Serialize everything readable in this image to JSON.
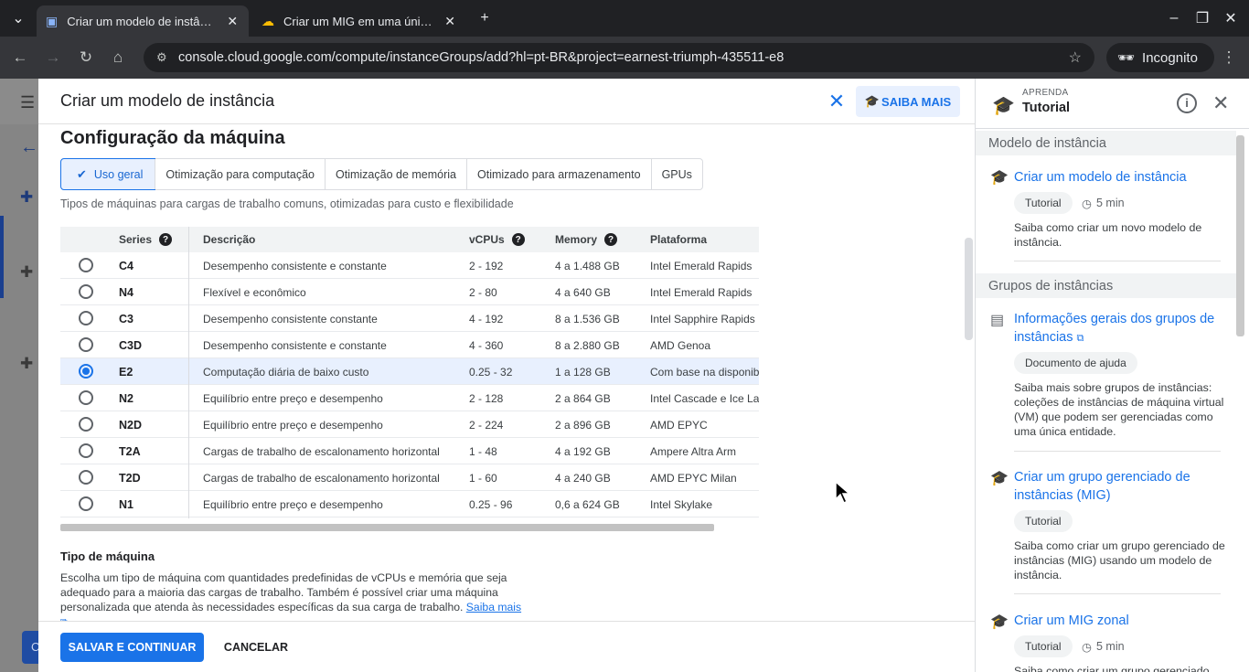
{
  "browser": {
    "tabs": [
      {
        "title": "Criar um modelo de instância",
        "active": true
      },
      {
        "title": "Criar um MIG em uma única zona",
        "active": false
      }
    ],
    "url": "console.cloud.google.com/compute/instanceGroups/add?hl=pt-BR&project=earnest-triumph-435511-e8",
    "incognito_label": "Incognito"
  },
  "dialog": {
    "title": "Criar um modelo de instância",
    "learn_more": "SAIBA MAIS",
    "section_title": "Configuração da máquina",
    "family_tabs": [
      {
        "label": "Uso geral",
        "selected": true
      },
      {
        "label": "Otimização para computação",
        "selected": false
      },
      {
        "label": "Otimização de memória",
        "selected": false
      },
      {
        "label": "Otimizado para armazenamento",
        "selected": false
      },
      {
        "label": "GPUs",
        "selected": false
      }
    ],
    "family_description": "Tipos de máquinas para cargas de trabalho comuns, otimizadas para custo e flexibilidade",
    "table": {
      "headers": {
        "series": "Series",
        "description": "Descrição",
        "vcpus": "vCPUs",
        "memory": "Memory",
        "platform": "Plataforma"
      },
      "rows": [
        {
          "series": "C4",
          "description": "Desempenho consistente e constante",
          "vcpus": "2 - 192",
          "memory": "4 a 1.488 GB",
          "platform": "Intel Emerald Rapids",
          "selected": false
        },
        {
          "series": "N4",
          "description": "Flexível e econômico",
          "vcpus": "2 - 80",
          "memory": "4 a 640 GB",
          "platform": "Intel Emerald Rapids",
          "selected": false
        },
        {
          "series": "C3",
          "description": "Desempenho consistente constante",
          "vcpus": "4 - 192",
          "memory": "8 a 1.536 GB",
          "platform": "Intel Sapphire Rapids",
          "selected": false
        },
        {
          "series": "C3D",
          "description": "Desempenho consistente e constante",
          "vcpus": "4 - 360",
          "memory": "8 a 2.880 GB",
          "platform": "AMD Genoa",
          "selected": false
        },
        {
          "series": "E2",
          "description": "Computação diária de baixo custo",
          "vcpus": "0.25 - 32",
          "memory": "1 a 128 GB",
          "platform": "Com base na disponibilidade",
          "selected": true
        },
        {
          "series": "N2",
          "description": "Equilíbrio entre preço e desempenho",
          "vcpus": "2 - 128",
          "memory": "2 a 864 GB",
          "platform": "Intel Cascade e Ice Lake",
          "selected": false
        },
        {
          "series": "N2D",
          "description": "Equilíbrio entre preço e desempenho",
          "vcpus": "2 - 224",
          "memory": "2 a 896 GB",
          "platform": "AMD EPYC",
          "selected": false
        },
        {
          "series": "T2A",
          "description": "Cargas de trabalho de escalonamento horizontal",
          "vcpus": "1 - 48",
          "memory": "4 a 192 GB",
          "platform": "Ampere Altra Arm",
          "selected": false
        },
        {
          "series": "T2D",
          "description": "Cargas de trabalho de escalonamento horizontal",
          "vcpus": "1 - 60",
          "memory": "4 a 240 GB",
          "platform": "AMD EPYC Milan",
          "selected": false
        },
        {
          "series": "N1",
          "description": "Equilíbrio entre preço e desempenho",
          "vcpus": "0.25 - 96",
          "memory": "0,6 a 624 GB",
          "platform": "Intel Skylake",
          "selected": false
        }
      ]
    },
    "machine_type": {
      "title": "Tipo de máquina",
      "text": "Escolha um tipo de máquina com quantidades predefinidas de vCPUs e memória que seja adequado para a maioria das cargas de trabalho. Também é possível criar uma máquina personalizada que atenda às necessidades específicas da sua carga de trabalho.",
      "link": "Saiba mais"
    },
    "save_button": "SALVAR E CONTINUAR",
    "cancel_button": "CANCELAR"
  },
  "tutorial_panel": {
    "label": "APRENDA",
    "title": "Tutorial",
    "sections": [
      {
        "heading": "Modelo de instância"
      },
      {
        "heading": "Grupos de instâncias"
      }
    ],
    "items": [
      {
        "title": "Criar um modelo de instância",
        "chip": "Tutorial",
        "duration": "5 min",
        "desc": "Saiba como criar um novo modelo de instância."
      },
      {
        "title": "Informações gerais dos grupos de instâncias",
        "chip": "Documento de ajuda",
        "desc": "Saiba mais sobre grupos de instâncias: coleções de instâncias de máquina virtual (VM) que podem ser gerenciadas como uma única entidade."
      },
      {
        "title": "Criar um grupo gerenciado de instâncias (MIG)",
        "chip": "Tutorial",
        "desc": "Saiba como criar um grupo gerenciado de instâncias (MIG) usando um modelo de instância."
      },
      {
        "title": "Criar um MIG zonal",
        "chip": "Tutorial",
        "duration": "5 min",
        "desc": "Saiba como criar um grupo gerenciado"
      }
    ]
  },
  "colors": {
    "accent": "#1a73e8",
    "selected_bg": "#e8f0fe"
  }
}
